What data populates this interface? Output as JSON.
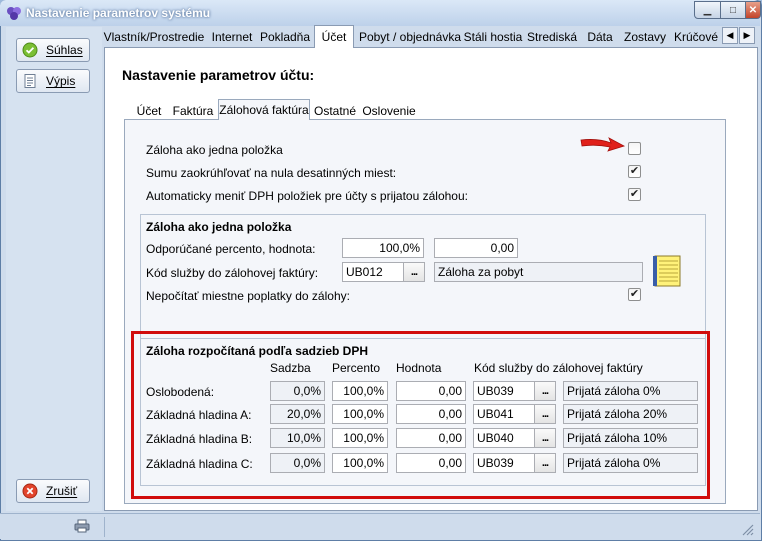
{
  "window": {
    "title": "Nastavenie parametrov systému"
  },
  "sidebar": {
    "accept_label": "Súhlas",
    "list_label": "Výpis",
    "cancel_label": "Zrušiť"
  },
  "tabs": [
    {
      "label": "Vlastník/Prostredie"
    },
    {
      "label": "Internet"
    },
    {
      "label": "Pokladňa"
    },
    {
      "label": "Účet",
      "active": true
    },
    {
      "label": "Pobyt / objednávka"
    },
    {
      "label": "Stáli hostia"
    },
    {
      "label": "Strediská"
    },
    {
      "label": "Dáta"
    },
    {
      "label": "Zostavy"
    },
    {
      "label": "Krúčové"
    }
  ],
  "page": {
    "title": "Nastavenie parametrov účtu:"
  },
  "subtabs": [
    {
      "label": "Účet"
    },
    {
      "label": "Faktúra"
    },
    {
      "label": "Zálohová faktúra",
      "active": true
    },
    {
      "label": "Ostatné"
    },
    {
      "label": "Oslovenie"
    }
  ],
  "options": [
    {
      "label": "Záloha ako jedna položka",
      "checked": false
    },
    {
      "label": "Sumu zaokrúhľovať na nula desatinných miest:",
      "checked": true
    },
    {
      "label": "Automaticky meniť DPH položiek pre účty s prijatou zálohou:",
      "checked": true
    }
  ],
  "single_group": {
    "title": "Záloha ako jedna položka",
    "percent_label": "Odporúčané percento, hodnota:",
    "percent_value": "100,0%",
    "amount_value": "0,00",
    "service_label": "Kód služby do zálohovej faktúry:",
    "service_code": "UB012",
    "service_name": "Záloha za pobyt",
    "fees_label": "Nepočítať miestne poplatky do zálohy:",
    "fees_checked": true,
    "dots": "..."
  },
  "vat_group": {
    "title": "Záloha rozpočítaná podľa sadzieb DPH",
    "headers": {
      "rate": "Sadzba",
      "percent": "Percento",
      "value": "Hodnota",
      "code": "Kód služby do zálohovej faktúry"
    },
    "rows": [
      {
        "label": "Oslobodená:",
        "rate": "0,0%",
        "percent": "100,0%",
        "value": "0,00",
        "code": "UB039",
        "name": "Prijatá záloha 0%"
      },
      {
        "label": "Základná hladina A:",
        "rate": "20,0%",
        "percent": "100,0%",
        "value": "0,00",
        "code": "UB041",
        "name": "Prijatá záloha 20%"
      },
      {
        "label": "Základná hladina B:",
        "rate": "10,0%",
        "percent": "100,0%",
        "value": "0,00",
        "code": "UB040",
        "name": "Prijatá záloha 10%"
      },
      {
        "label": "Základná hladina C:",
        "rate": "0,0%",
        "percent": "100,0%",
        "value": "0,00",
        "code": "UB039",
        "name": "Prijatá záloha 0%"
      }
    ],
    "dots": "..."
  },
  "colors": {
    "highlight": "#d10c0c",
    "arrow": "#e0201a"
  }
}
